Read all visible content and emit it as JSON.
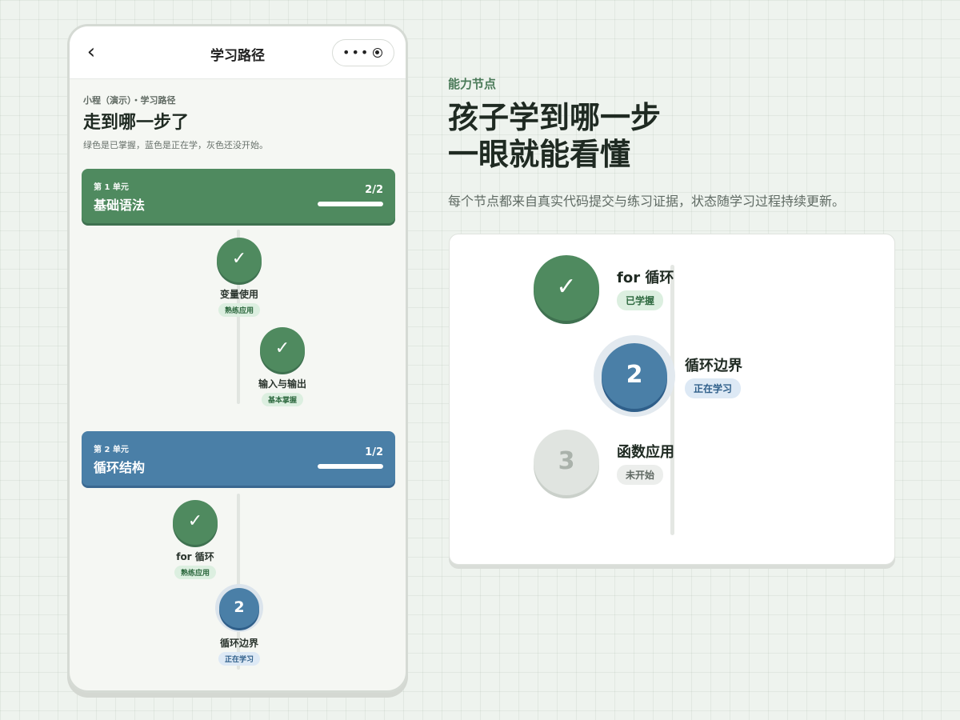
{
  "phone": {
    "nav": {
      "back": "‹",
      "title": "学习路径",
      "menu_dots": "•••"
    },
    "breadcrumb": "小程（演示）・学习路径",
    "page_title": "走到哪一步了",
    "page_desc": "绿色是已掌握，蓝色是正在学，灰色还没开始。",
    "units": [
      {
        "label": "第 1 单元",
        "name": "基础语法",
        "count": "2/2",
        "progress": 1.0,
        "color": "#4f8a5f",
        "nodes": [
          {
            "symbol": "✓",
            "name": "变量使用",
            "badge": "熟练应用",
            "state": "done"
          },
          {
            "symbol": "✓",
            "name": "输入与输出",
            "badge": "基本掌握",
            "state": "done"
          }
        ]
      },
      {
        "label": "第 2 单元",
        "name": "循环结构",
        "count": "1/2",
        "progress": 1.0,
        "color": "#4a7fa7",
        "nodes": [
          {
            "symbol": "✓",
            "name": "for 循环",
            "badge": "熟练应用",
            "state": "done"
          },
          {
            "symbol": "2",
            "name": "循环边界",
            "badge": "正在学习",
            "state": "doing"
          }
        ]
      }
    ]
  },
  "panel": {
    "eyebrow": "能力节点",
    "headline_line1": "孩子学到哪一步",
    "headline_line2": "一眼就能看懂",
    "subline": "每个节点都来自真实代码提交与练习证据，状态随学习过程持续更新。",
    "nodes": [
      {
        "symbol": "✓",
        "name": "for 循环",
        "badge": "已学握",
        "state": "done"
      },
      {
        "symbol": "2",
        "name": "循环边界",
        "badge": "正在学习",
        "state": "doing"
      },
      {
        "symbol": "3",
        "name": "函数应用",
        "badge": "未开始",
        "state": "todo"
      }
    ]
  },
  "colors": {
    "mastered": "#4f8a5f",
    "learning": "#4a7fa7",
    "not_started": "#dde2dd",
    "background": "#eef3ee"
  }
}
